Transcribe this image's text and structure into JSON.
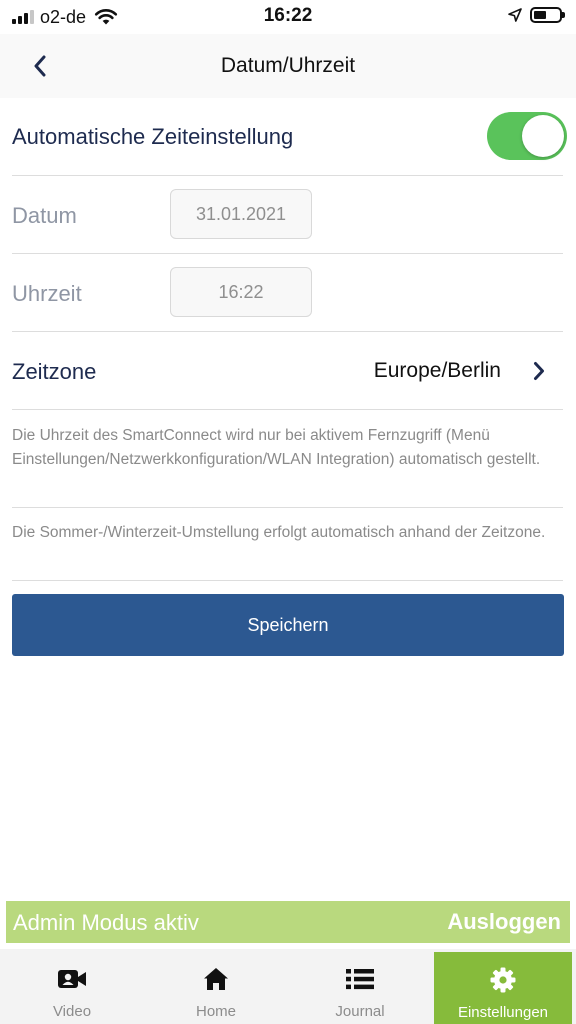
{
  "status_bar": {
    "carrier": "o2-de",
    "time": "16:22",
    "icons": [
      "signal-icon",
      "wifi-icon",
      "location-icon",
      "battery-icon"
    ]
  },
  "nav": {
    "title": "Datum/Uhrzeit",
    "back_icon": "chevron-left-icon"
  },
  "settings": {
    "auto_time": {
      "label": "Automatische Zeiteinstellung",
      "enabled": true
    },
    "date": {
      "label": "Datum",
      "value": "31.01.2021"
    },
    "time": {
      "label": "Uhrzeit",
      "value": "16:22"
    },
    "timezone": {
      "label": "Zeitzone",
      "value": "Europe/Berlin"
    }
  },
  "notes": [
    "Die Uhrzeit des SmartConnect wird nur bei aktivem Fernzugriff (Menü Einstellungen/Netzwerkkonfiguration/WLAN Integration) automatisch gestellt.",
    "Die Sommer-/Winterzeit-Umstellung erfolgt automatisch anhand der Zeitzone."
  ],
  "save_label": "Speichern",
  "admin_banner": {
    "text": "Admin Modus aktiv",
    "logout_label": "Ausloggen"
  },
  "tabs": [
    {
      "label": "Video",
      "icon": "video-icon",
      "active": false
    },
    {
      "label": "Home",
      "icon": "home-icon",
      "active": false
    },
    {
      "label": "Journal",
      "icon": "list-icon",
      "active": false
    },
    {
      "label": "Einstellungen",
      "icon": "gear-icon",
      "active": true
    }
  ],
  "colors": {
    "accent_blue": "#2c5891",
    "toggle_green": "#5ac35b",
    "tab_active_green": "#86bb3b",
    "admin_banner_green": "#b9d97e",
    "label_navy": "#1e2b4f"
  }
}
